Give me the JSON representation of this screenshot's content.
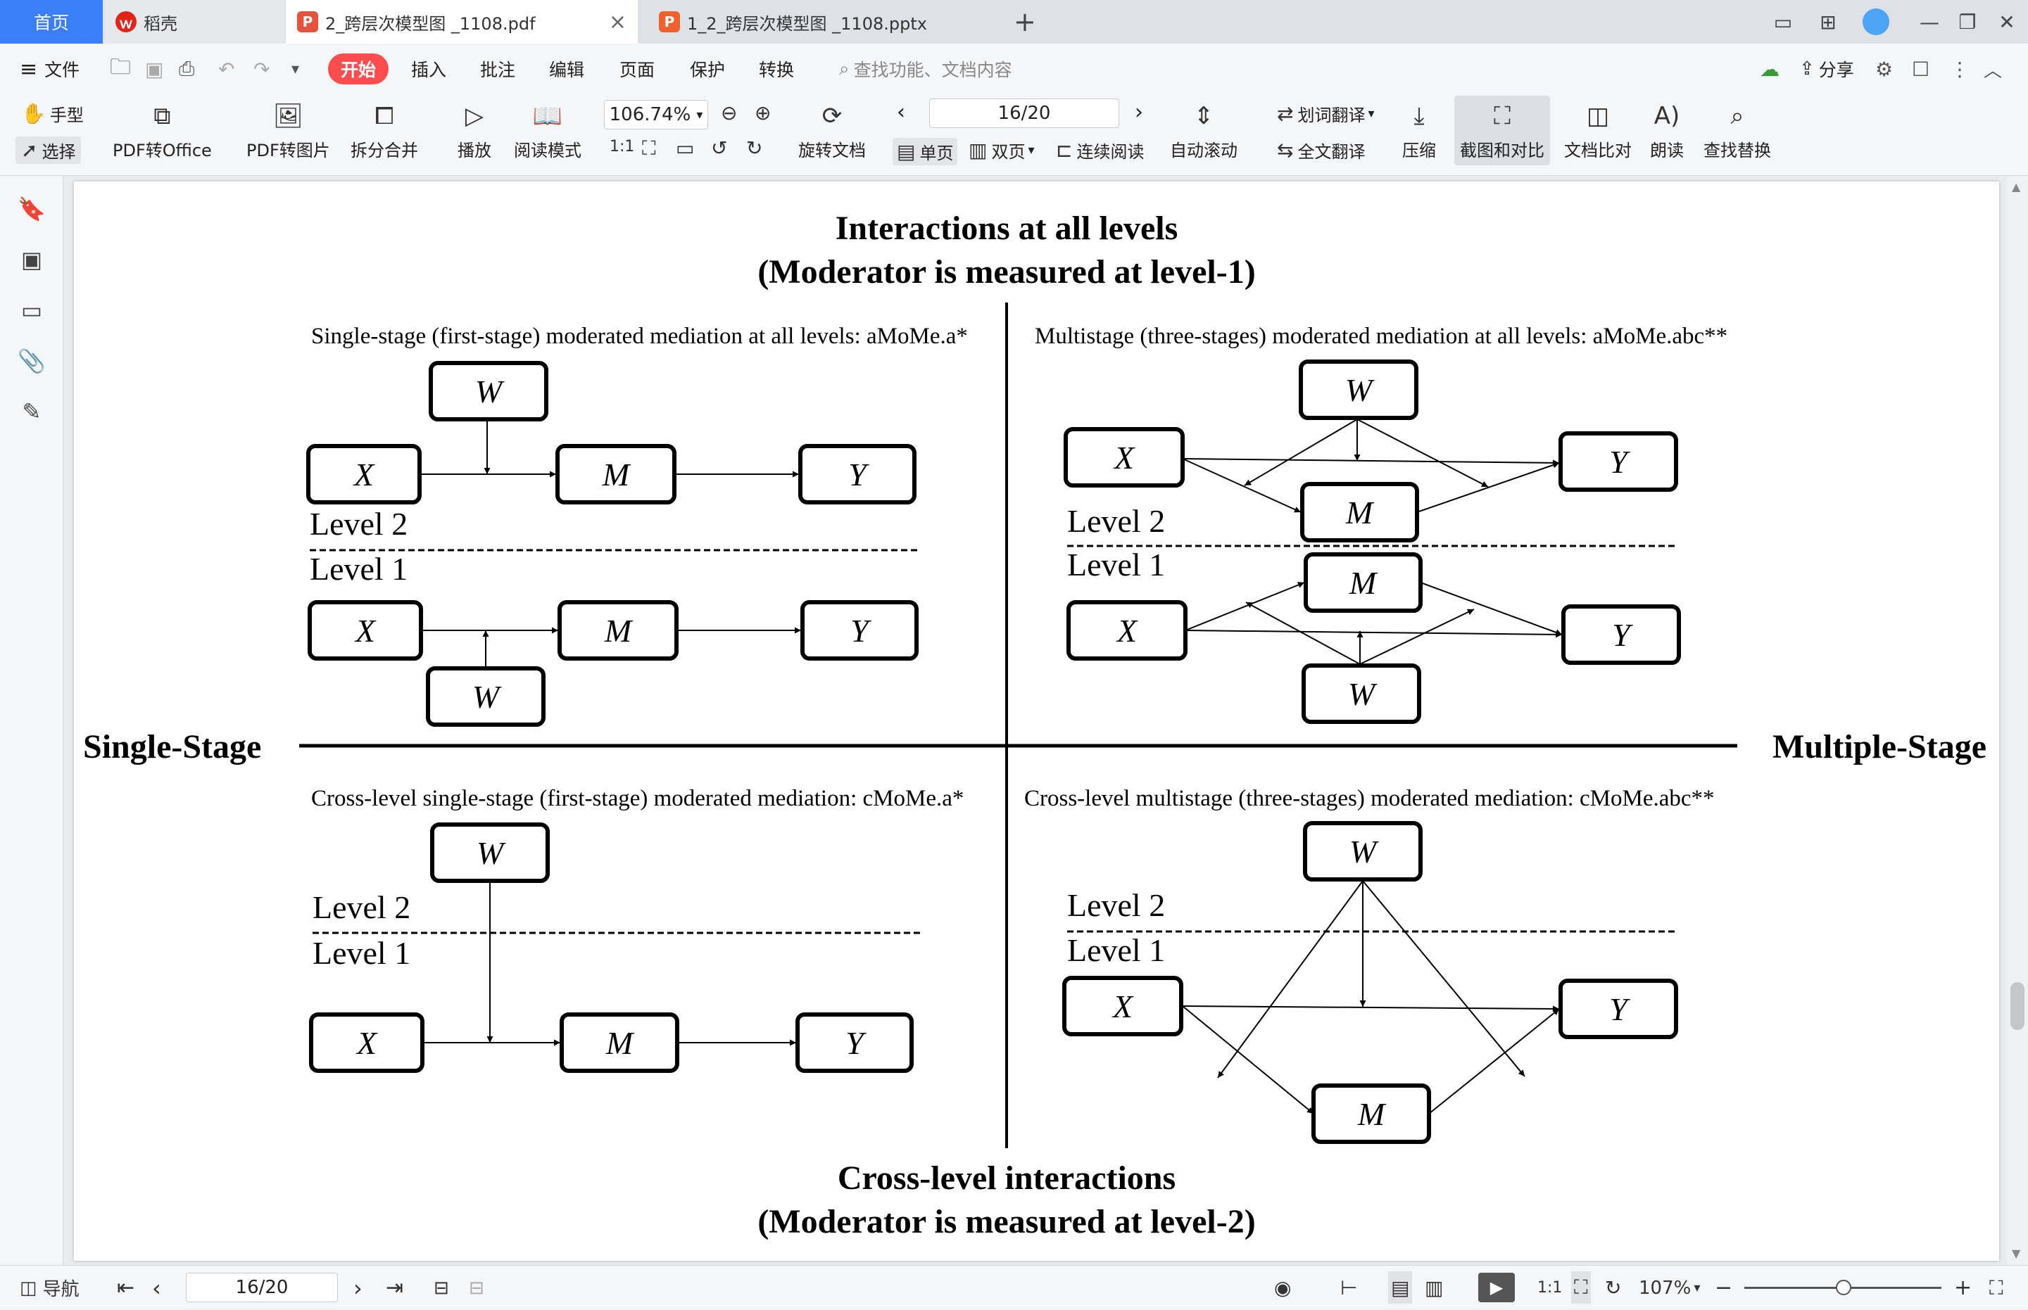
{
  "tabs": {
    "home": "首页",
    "docer": "稻壳",
    "pdf_tab": "2_跨层次模型图 _1108.pdf",
    "pptx_tab": "1_2_跨层次模型图 _1108.pptx",
    "new_tab": "+"
  },
  "menu": {
    "file": "文件",
    "start": "开始",
    "insert": "插入",
    "annotate": "批注",
    "edit": "编辑",
    "page": "页面",
    "protect": "保护",
    "convert": "转换",
    "search_placeholder": "查找功能、文档内容",
    "share": "分享"
  },
  "toolbar": {
    "hand": "手型",
    "select": "选择",
    "pdf_to_office": "PDF转Office",
    "pdf_to_image": "PDF转图片",
    "split_merge": "拆分合并",
    "play": "播放",
    "read_mode": "阅读模式",
    "zoom": "106.74%",
    "rotate": "旋转文档",
    "page_indicator": "16/20",
    "single_page": "单页",
    "double_page": "双页",
    "continuous": "连续阅读",
    "auto_scroll": "自动滚动",
    "translate_words": "划词翻译",
    "translate_full": "全文翻译",
    "compress": "压缩",
    "screenshot_compare": "截图和对比",
    "doc_compare": "文档比对",
    "read_aloud": "朗读",
    "find_replace": "查找替换"
  },
  "status": {
    "nav": "导航",
    "page_indicator": "16/20",
    "zoom": "107%"
  },
  "figure": {
    "top_title_1": "Interactions at all levels",
    "top_title_2": "(Moderator is measured at level-1)",
    "bottom_title_1": "Cross-level interactions",
    "bottom_title_2": "(Moderator is measured at level-2)",
    "left_label": "Single-Stage",
    "right_label": "Multiple-Stage",
    "q1_caption": "Single-stage (first-stage) moderated mediation at all levels: aMoMe.a*",
    "q2_caption": "Multistage (three-stages) moderated mediation at all levels: aMoMe.abc**",
    "q3_caption": "Cross-level single-stage (first-stage) moderated mediation: cMoMe.a*",
    "q4_caption": "Cross-level multistage (three-stages) moderated mediation: cMoMe.abc**",
    "level2": "Level 2",
    "level1": "Level 1",
    "node_x": "X",
    "node_m": "M",
    "node_y": "Y",
    "node_w": "W"
  }
}
